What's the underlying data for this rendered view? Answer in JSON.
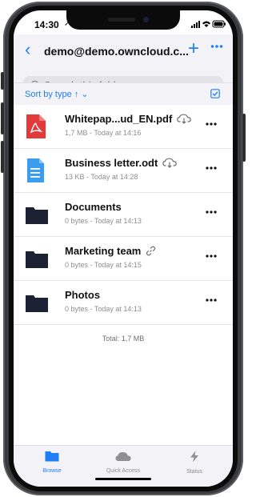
{
  "status_bar": {
    "time": "14:30"
  },
  "header": {
    "title": "demo@demo.owncloud.c...",
    "search_placeholder": "Search this folder"
  },
  "sort": {
    "label": "Sort by type ↑ ⌄"
  },
  "files": [
    {
      "name": "Whitepap...ud_EN.pdf",
      "meta": "1,7 MB - Today at 14:16",
      "icon": "pdf-icon",
      "badge": "cloud-download-icon"
    },
    {
      "name": "Business letter.odt",
      "meta": "13 KB - Today at 14:28",
      "icon": "document-icon",
      "badge": "cloud-download-icon"
    },
    {
      "name": "Documents",
      "meta": "0 bytes - Today at 14:13",
      "icon": "folder-icon",
      "badge": ""
    },
    {
      "name": "Marketing team",
      "meta": "0 bytes - Today at 14:15",
      "icon": "folder-icon",
      "badge": "link-icon"
    },
    {
      "name": "Photos",
      "meta": "0 bytes - Today at 14:13",
      "icon": "folder-icon",
      "badge": ""
    }
  ],
  "total": "Total: 1,7 MB",
  "tabs": [
    {
      "label": "Browse",
      "icon": "folder-icon",
      "active": true
    },
    {
      "label": "Quick Access",
      "icon": "cloud-icon",
      "active": false
    },
    {
      "label": "Status",
      "icon": "bolt-icon",
      "active": false
    }
  ],
  "colors": {
    "accent": "#1f7ff5",
    "pdf": "#e03a3a",
    "doc": "#3b9cf0",
    "folder": "#1c2233"
  }
}
